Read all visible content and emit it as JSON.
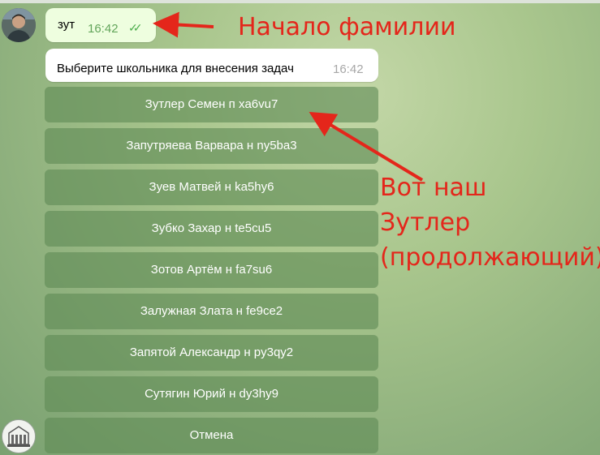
{
  "chat": {
    "outgoing": {
      "text": "зут",
      "time": "16:42"
    },
    "incoming": {
      "text": "Выберите школьника для внесения задач",
      "time": "16:42"
    }
  },
  "keyboard": {
    "buttons": [
      "Зутлер Семен п xa6vu7",
      "Запутряева Варвара н ny5ba3",
      "Зуев Матвей н ka5hy6",
      "Зубко Захар н te5cu5",
      "Зотов Артём н fa7su6",
      "Залужная Злата н fe9ce2",
      "Запятой Александр н py3qy2",
      "Сутягин Юрий н dy3hy9",
      "Отмена"
    ]
  },
  "annotations": {
    "top": "Начало фамилии",
    "side": [
      "Вот наш",
      "Зутлер",
      "(продолжающий)"
    ],
    "color": "#e4261b"
  }
}
